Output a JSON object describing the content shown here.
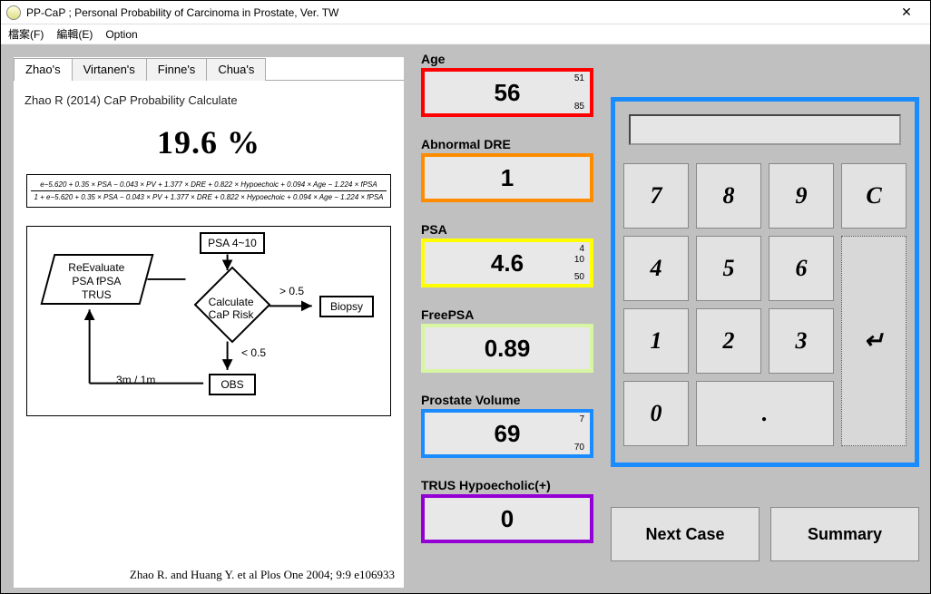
{
  "window": {
    "title": "PP-CaP ; Personal Probability of Carcinoma in Prostate, Ver. TW",
    "close": "✕"
  },
  "menu": {
    "file": "檔案(F)",
    "edit": "編輯(E)",
    "option": "Option"
  },
  "tabs": [
    "Zhao's",
    "Virtanen's",
    "Finne's",
    "Chua's"
  ],
  "panel": {
    "ref": "Zhao R (2014) CaP Probability Calculate",
    "percent": "19.6 %",
    "formula_num": "e−5.620 + 0.35 × PSA − 0.043 × PV + 1.377 × DRE + 0.822 × Hypoechoic + 0.094 × Age − 1.224 × fPSA",
    "formula_den": "1 + e−5.620 + 0.35 × PSA − 0.043 × PV + 1.377 × DRE + 0.822 × Hypoechoic + 0.094 × Age − 1.224 × fPSA",
    "flow": {
      "reeval1": "ReEvaluate",
      "reeval2": "PSA  fPSA",
      "reeval3": "TRUS",
      "psa410": "PSA 4~10",
      "calc1": "Calculate",
      "calc2": "CaP Risk",
      "gt": "> 0.5",
      "lt": "< 0.5",
      "biopsy": "Biopsy",
      "obs": "OBS",
      "interval": "3m / 1m"
    },
    "citation": "Zhao R.  and Huang Y. et al   Plos One 2004; 9:9 e106933"
  },
  "fields": {
    "age": {
      "label": "Age",
      "value": "56",
      "min": "51",
      "max": "85",
      "border": "#ff0000"
    },
    "dre": {
      "label": "Abnormal DRE",
      "value": "1",
      "border": "#ff8c00"
    },
    "psa": {
      "label": "PSA",
      "value": "4.6",
      "min": "4",
      "mid": "10",
      "max": "50",
      "border": "#ffff00"
    },
    "fpsa": {
      "label": "FreePSA",
      "value": "0.89",
      "border": "#d8f5a3"
    },
    "pv": {
      "label": "Prostate Volume",
      "value": "69",
      "min": "7",
      "max": "70",
      "border": "#1a8cff"
    },
    "hypo": {
      "label": "TRUS Hypoecholic(+)",
      "value": "0",
      "border": "#9400d3"
    }
  },
  "keypad": {
    "k7": "7",
    "k8": "8",
    "k9": "9",
    "kC": "C",
    "k4": "4",
    "k5": "5",
    "k6": "6",
    "k1": "1",
    "k2": "2",
    "k3": "3",
    "k0": "0",
    "kdot": ".",
    "kenter": "↵"
  },
  "buttons": {
    "next": "Next Case",
    "summary": "Summary"
  }
}
